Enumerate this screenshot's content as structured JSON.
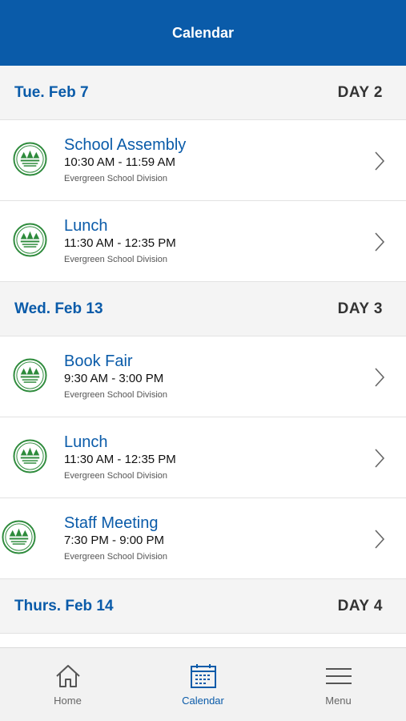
{
  "header": {
    "title": "Calendar"
  },
  "days": [
    {
      "date": "Tue. Feb 7",
      "day": "DAY 2",
      "events": [
        {
          "title": "School Assembly",
          "time": "10:30 AM - 11:59 AM",
          "org": "Evergreen School Division"
        },
        {
          "title": "Lunch",
          "time": "11:30 AM - 12:35 PM",
          "org": "Evergreen School Division"
        }
      ]
    },
    {
      "date": "Wed. Feb 13",
      "day": "DAY 3",
      "events": [
        {
          "title": "Book Fair",
          "time": "9:30 AM - 3:00 PM",
          "org": "Evergreen School Division"
        },
        {
          "title": "Lunch",
          "time": "11:30 AM - 12:35 PM",
          "org": "Evergreen School Division"
        },
        {
          "title": "Staff Meeting",
          "time": "7:30 PM - 9:00 PM",
          "org": "Evergreen School Division"
        }
      ]
    },
    {
      "date": "Thurs. Feb 14",
      "day": "DAY 4",
      "events": []
    }
  ],
  "tabs": [
    {
      "label": "Home",
      "icon": "home-icon",
      "active": false
    },
    {
      "label": "Calendar",
      "icon": "calendar-icon",
      "active": true
    },
    {
      "label": "Menu",
      "icon": "menu-icon",
      "active": false
    }
  ],
  "colors": {
    "brand": "#0a5ba9",
    "logo": "#2e8b3c",
    "background": "#f4f4f4"
  },
  "logo_icon": "evergreen-school-logo-icon",
  "chevron_icon": "chevron-right-icon"
}
